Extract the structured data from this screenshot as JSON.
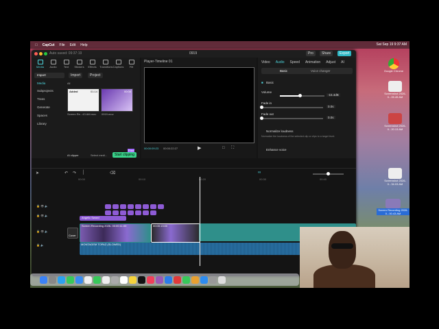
{
  "menubar": {
    "app_name": "CapCut",
    "items": [
      "File",
      "Edit",
      "Help"
    ],
    "clock": "Sat Sep 19  9:37 AM"
  },
  "window": {
    "autosave": "Auto saved: 09:37:19",
    "title": "0919",
    "pro_label": "Pro",
    "share_label": "Share",
    "export_label": "Export"
  },
  "media_tabs": [
    {
      "label": "Media",
      "icon": "media-icon",
      "active": true
    },
    {
      "label": "Audio",
      "icon": "audio-icon"
    },
    {
      "label": "Text",
      "icon": "text-icon"
    },
    {
      "label": "Stickers",
      "icon": "sticker-icon"
    },
    {
      "label": "Effects",
      "icon": "effects-icon"
    },
    {
      "label": "Transitions",
      "icon": "transitions-icon"
    },
    {
      "label": "Captions",
      "icon": "captions-icon"
    },
    {
      "label": "Filt",
      "icon": "filter-icon"
    }
  ],
  "sidebar": {
    "import_tab": "Import",
    "items": [
      "Media",
      "Subprojects",
      "Trees",
      "Generate",
      "Spaces",
      "Library"
    ]
  },
  "media_panel": {
    "import_button": "Import",
    "project_label": "Project",
    "all_label": "All",
    "added_badge": "Added",
    "clip1_name": "Screen Re...43 AM.mov",
    "clip1_duration": "01:14",
    "clip2_name": "0919.mov",
    "clip2_duration": "00:08",
    "ai_clipper": "AI clipper",
    "select_media": "Select medi...",
    "start_clipping": "Start clipping",
    "free_badge": "Free"
  },
  "player": {
    "title": "Player-Timeline 01",
    "time_current": "00:00:09:23",
    "time_total": "00:00:22:27"
  },
  "properties": {
    "tabs": [
      "Video",
      "Audio",
      "Speed",
      "Animation",
      "Adjust",
      "AI"
    ],
    "active_tab": "Audio",
    "seg_basic": "Basic",
    "seg_voice": "Voice changer",
    "section_basic": "Basic",
    "volume_label": "Volume",
    "volume_value": "-15.4dB",
    "volume_fraction": 0.45,
    "fadein_label": "Fade in",
    "fadein_value": "0.0s",
    "fadeout_label": "Fade out",
    "fadeout_value": "0.0s",
    "normalize_label": "Normalize loudness",
    "normalize_desc": "Normalize the loudness of the selected clip or clips to a target level.",
    "enhance_label": "Enhance voice"
  },
  "timeline": {
    "ruler": [
      "00:00",
      "",
      "00:10",
      "",
      "00:20",
      "",
      "00:30",
      "",
      "00:40"
    ],
    "text_track_label": "Angelic Sword",
    "video_clip_label": "Screen Recording 2026-  00:00:11:00",
    "video_clip2_label": "00:00:13:00",
    "audio_track_label": "MONTAGEM TOPAZ (SLOWED)",
    "cover_label": "Cover"
  },
  "desktop": {
    "icons": [
      "Google Chrome",
      "Screenshot 2026-0...05.45 AM",
      "Screenshot 2026-0...20.13 AM",
      "Screenshot 2026-0...34.03 AM",
      "Screen Recording 2026-0...00.43 AM"
    ]
  },
  "colors": {
    "accent": "#4fd8e0",
    "clip_purple": "#8e5bd6",
    "video_teal": "#2f8f8a",
    "audio_blue": "#1f5a86",
    "start_clip_green": "#3ad28a"
  }
}
